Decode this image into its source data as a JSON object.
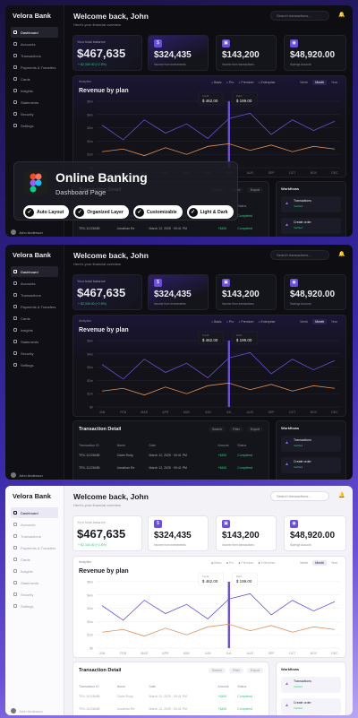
{
  "brand": "Velora Bank",
  "nav": [
    "Dashboard",
    "Accounts",
    "Transactions",
    "Payments & Transfers",
    "Cards",
    "Insights",
    "Statements",
    "Security",
    "Settings"
  ],
  "user": {
    "name": "John Anderson"
  },
  "header": {
    "title": "Welcome back, John",
    "subtitle": "Here's your financial overview",
    "search_placeholder": "Search transactions..."
  },
  "cards": {
    "balance": {
      "label": "Your total balance",
      "value": "$467,635",
      "change": "+ $2,330.00 (+2.5%)"
    },
    "investments": {
      "value": "$324,435",
      "caption": "Income from investments"
    },
    "transactions": {
      "value": "$143,200",
      "caption": "Income from transactions"
    },
    "savings": {
      "value": "$48,920.00",
      "caption": "Savings Account"
    }
  },
  "chart": {
    "caption": "Analytics",
    "title": "Revenue by plan",
    "legend": [
      "Basic",
      "Pro",
      "Premium",
      "Enterprise"
    ],
    "periods": [
      "Week",
      "Month",
      "Year"
    ],
    "tooltip": {
      "a": "$ 462.00",
      "b": "$ 199.00",
      "la": "Credit",
      "lb": "Debit"
    }
  },
  "chart_data": {
    "type": "line",
    "categories": [
      "JAN",
      "FEB",
      "MAR",
      "APR",
      "MAY",
      "JUN",
      "JUL",
      "AUG",
      "SEP",
      "OCT",
      "NOV",
      "DEC"
    ],
    "yticks": [
      "$5m",
      "$4m",
      "$3m",
      "$2m",
      "$1m",
      "$0"
    ],
    "ylim": [
      0,
      5
    ],
    "series": [
      {
        "color": "#6b4fd6",
        "values": [
          3.2,
          2.1,
          3.6,
          2.6,
          3.3,
          2.2,
          3.7,
          4.1,
          2.5,
          3.6,
          2.8,
          3.5
        ]
      },
      {
        "color": "#e0905a",
        "values": [
          1.2,
          1.4,
          0.9,
          1.5,
          1.0,
          1.6,
          1.8,
          1.3,
          1.7,
          1.2,
          1.6,
          1.4
        ]
      }
    ]
  },
  "tx": {
    "title": "Transaction Detail",
    "search": "Search",
    "filter": "Filter",
    "export": "Export",
    "cols": [
      "Transaction ID",
      "Name",
      "Date",
      "Amount",
      "Status"
    ],
    "rows": [
      [
        "TRX-11226485",
        "Claire Rudy",
        "March 12, 2025 · 09:41 PM",
        "+$450",
        "Completed"
      ],
      [
        "TRX-11226485",
        "Jonathan Re",
        "March 12, 2025 · 09:41 PM",
        "+$450",
        "Completed"
      ]
    ]
  },
  "workflows": {
    "title": "Workflows",
    "items": [
      {
        "label": "Transactions",
        "sub": "Verified"
      },
      {
        "label": "Create order",
        "sub": "Verified"
      }
    ]
  },
  "overlay": {
    "title": "Online Banking",
    "subtitle": "Dashboard Page",
    "pills": [
      "Auto Layout",
      "Organized Layer",
      "Customizable",
      "Light & Dark"
    ]
  }
}
